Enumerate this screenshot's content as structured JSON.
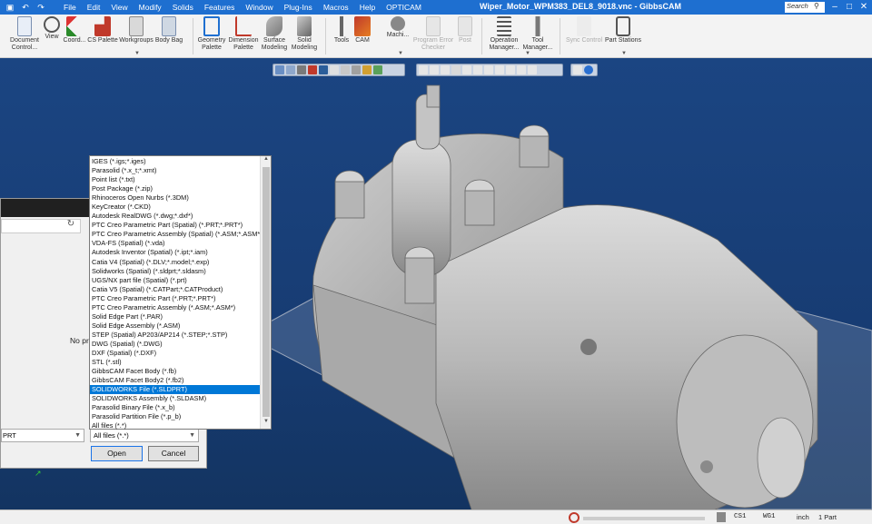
{
  "title_bar": {
    "window_title": "Wiper_Motor_WPM383_DEL8_9018.vnc - GibbsCAM",
    "menus": [
      "File",
      "Edit",
      "View",
      "Modify",
      "Solids",
      "Features",
      "Window",
      "Plug-Ins",
      "Macros",
      "Help",
      "OPTICAM"
    ],
    "search_placeholder": "Search"
  },
  "ribbon": {
    "buttons": [
      {
        "label": "Document Control...",
        "icon": "document-control-icon"
      },
      {
        "label": "View",
        "icon": "view-icon"
      },
      {
        "label": "Coord...",
        "icon": "coord-icon"
      },
      {
        "label": "CS Palette",
        "icon": "cs-palette-icon"
      },
      {
        "label": "Workgroups",
        "icon": "workgroups-icon"
      },
      {
        "label": "Body Bag",
        "icon": "body-bag-icon"
      },
      {
        "label": "Geometry Palette",
        "icon": "geometry-palette-icon"
      },
      {
        "label": "Dimension Palette",
        "icon": "dimension-palette-icon"
      },
      {
        "label": "Surface Modeling",
        "icon": "surface-modeling-icon"
      },
      {
        "label": "Solid Modeling",
        "icon": "solid-modeling-icon"
      },
      {
        "label": "Tools",
        "icon": "tools-icon"
      },
      {
        "label": "CAM",
        "icon": "cam-icon"
      },
      {
        "label": "Machi...",
        "icon": "machine-icon"
      },
      {
        "label": "Program Error Checker",
        "icon": "program-error-checker-icon"
      },
      {
        "label": "Post",
        "icon": "post-icon"
      },
      {
        "label": "Operation Manager...",
        "icon": "operation-manager-icon"
      },
      {
        "label": "Tool Manager...",
        "icon": "tool-manager-icon"
      },
      {
        "label": "Sync Control",
        "icon": "sync-control-icon"
      },
      {
        "label": "Part Stations",
        "icon": "part-stations-icon"
      }
    ]
  },
  "dialog": {
    "no_preview_text": "No pre",
    "filename_value": "PRT",
    "filetype_value": "All files (*.*)",
    "open_label": "Open",
    "cancel_label": "Cancel"
  },
  "filetype_list": {
    "items": [
      "IGES (*.igs;*.iges)",
      "Parasolid (*.x_t;*.xmt)",
      "Point list (*.txt)",
      "Post Package (*.zip)",
      "Rhinoceros Open Nurbs (*.3DM)",
      "KeyCreator (*.CKD)",
      "Autodesk RealDWG (*.dwg;*.dxf*)",
      "PTC Creo Parametric Part (Spatial) (*.PRT;*.PRT*)",
      "PTC Creo Parametric Assembly (Spatial) (*.ASM;*.ASM*)",
      "VDA-FS (Spatial) (*.vda)",
      "Autodesk Inventor (Spatial) (*.ipt;*.iam)",
      "Catia V4 (Spatial) (*.DLV;*.model;*.exp)",
      "Solidworks (Spatial) (*.sldprt;*.sldasm)",
      "UGS/NX part file (Spatial) (*.prt)",
      "Catia V5 (Spatial) (*.CATPart;*.CATProduct)",
      "PTC Creo Parametric Part (*.PRT;*.PRT*)",
      "PTC Creo Parametric Assembly (*.ASM;*.ASM*)",
      "Solid Edge Part (*.PAR)",
      "Solid Edge Assembly (*.ASM)",
      "STEP (Spatial) AP203/AP214 (*.STEP;*.STP)",
      "DWG (Spatial) (*.DWG)",
      "DXF (Spatial) (*.DXF)",
      "STL (*.stl)",
      "GibbsCAM Facet Body (*.fb)",
      "GibbsCAM Facet Body2 (*.fb2)",
      "SOLIDWORKS File (*.SLDPRT)",
      "SOLIDWORKS Assembly (*.SLDASM)",
      "Parasolid Binary File (*.x_b)",
      "Parasolid Partition File (*.p_b)",
      "All files (*.*)"
    ],
    "selected_index": 25
  },
  "status_bar": {
    "cs": "CS1",
    "workgroup": "WG1",
    "units": "inch",
    "parts": "1 Part"
  },
  "colors": {
    "title_bar": "#1e6fd0",
    "selection": "#0078d7",
    "viewport": "#1b4582"
  }
}
